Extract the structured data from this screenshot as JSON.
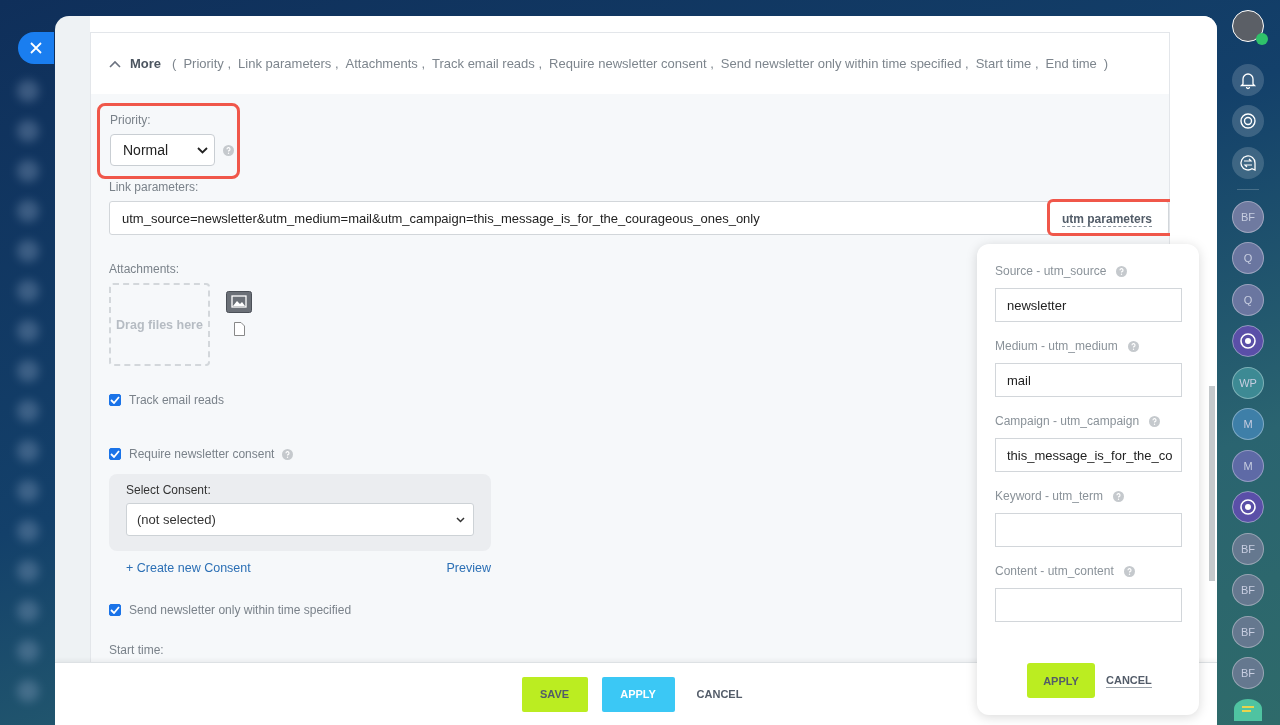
{
  "more": {
    "label": "More",
    "expanded": true,
    "open_paren": "(",
    "close_paren": ")",
    "items": [
      "Priority ,",
      "Link parameters ,",
      "Attachments ,",
      "Track email reads ,",
      "Require newsletter consent ,",
      "Send newsletter only within time specified ,",
      "Start time ,",
      "End time"
    ]
  },
  "priority": {
    "label": "Priority:",
    "value": "Normal",
    "highlighted": true
  },
  "link_parameters": {
    "label": "Link parameters:",
    "value": "utm_source=newsletter&utm_medium=mail&utm_campaign=this_message_is_for_the_courageous_ones_only",
    "utm_button": "utm parameters",
    "utm_highlighted": true
  },
  "attachments": {
    "label": "Attachments:",
    "dropzone": "Drag files here"
  },
  "checkboxes": [
    {
      "label": "Track email reads",
      "checked": true,
      "help": false
    },
    {
      "label": "Require newsletter consent",
      "checked": true,
      "help": true
    }
  ],
  "consent": {
    "label": "Select Consent:",
    "value": "(not selected)",
    "create_link": "+ Create new Consent",
    "preview_link": "Preview"
  },
  "time_checkbox": {
    "label": "Send newsletter only within time specified",
    "checked": true
  },
  "start_time": {
    "label": "Start time:"
  },
  "footer": {
    "save": "SAVE",
    "apply": "APPLY",
    "cancel": "CANCEL"
  },
  "utm_popover": {
    "fields": [
      {
        "label": "Source - utm_source",
        "value": "newsletter"
      },
      {
        "label": "Medium - utm_medium",
        "value": "mail"
      },
      {
        "label": "Campaign - utm_campaign",
        "value": "this_message_is_for_the_co"
      },
      {
        "label": "Keyword - utm_term"
      },
      {
        "label": "Content - utm_content"
      }
    ],
    "apply": "APPLY",
    "cancel": "CANCEL"
  },
  "right_sidebar": [
    {
      "kind": "avatar"
    },
    {
      "kind": "bell"
    },
    {
      "kind": "swirl"
    },
    {
      "kind": "exchange"
    },
    {
      "kind": "divider"
    },
    {
      "kind": "initials",
      "text": "BF",
      "color": "#6f7aa0"
    },
    {
      "kind": "initials",
      "text": "Q",
      "color": "#6a76a0"
    },
    {
      "kind": "initials",
      "text": "Q",
      "color": "#6a76a0"
    },
    {
      "kind": "logo",
      "color": "#5a4fa8"
    },
    {
      "kind": "initials",
      "text": "WP",
      "color": "#3d8a94"
    },
    {
      "kind": "initials",
      "text": "M",
      "color": "#3e7fa8"
    },
    {
      "kind": "initials",
      "text": "M",
      "color": "#5e6aa6"
    },
    {
      "kind": "logo",
      "color": "#5a4fa8"
    },
    {
      "kind": "initials",
      "text": "BF",
      "color": "#65788f"
    },
    {
      "kind": "initials",
      "text": "BF",
      "color": "#65788f"
    },
    {
      "kind": "initials",
      "text": "BF",
      "color": "#65788f"
    },
    {
      "kind": "initials",
      "text": "BF",
      "color": "#65788f"
    },
    {
      "kind": "chat"
    }
  ]
}
